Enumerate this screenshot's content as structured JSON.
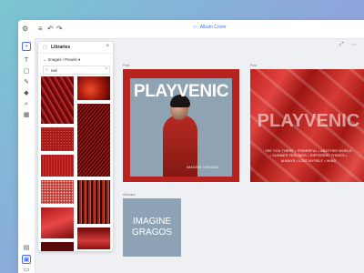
{
  "app": {
    "doc_title": "Album Cover"
  },
  "panel": {
    "title": "Libraries",
    "subtitle": "Images / Pexels",
    "search_value": "red",
    "close": "×"
  },
  "canvas": {
    "labels": {
      "a": "Post",
      "b": "Post",
      "c": "Artboard"
    },
    "card_a_title": "PLAYVENIC",
    "card_a_sub": "IMAGINE GRAGOS",
    "card_b_title": "PLAYVENIC",
    "card_b_text": "SEE YOU THERE • POWERFUL • ANOTHER WORLD • SUMMER FEELINGS • DIFFERENT THINGS • ALWAYS • LOST MYSELF • WIND",
    "card_c_title_line1": "IMAGINE",
    "card_c_title_line2": "GRAGOS"
  },
  "colors": {
    "accent": "#4a6cf7",
    "red": "#b8231f",
    "slate": "#8ea2b6"
  }
}
